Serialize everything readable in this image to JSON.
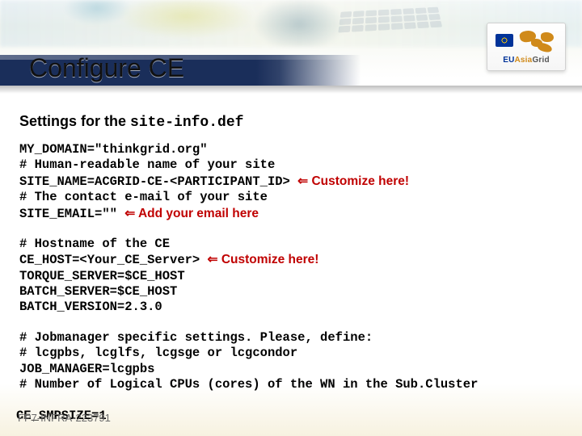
{
  "title": "Configure CE",
  "logo": {
    "eu": "EU",
    "asia": "Asia",
    "grid": "Grid"
  },
  "subhead_prefix": "Settings for the ",
  "subhead_file": "site-info.def",
  "block1": {
    "l1": "MY_DOMAIN=\"thinkgrid.org\"",
    "l2": "# Human-readable name of your site",
    "l3a": "SITE_NAME=ACGRID-CE-<PARTICIPANT_ID> ",
    "l3b": " Customize here!",
    "l4": "# The contact e-mail of your site",
    "l5a": "SITE_EMAIL=\"\" ",
    "l5b": " Add your email here"
  },
  "block2": {
    "l1": "# Hostname of the CE",
    "l2a": "CE_HOST=<Your_CE_Server> ",
    "l2b": " Customize here!",
    "l3": "TORQUE_SERVER=$CE_HOST",
    "l4": "BATCH_SERVER=$CE_HOST",
    "l5": "BATCH_VERSION=2.3.0"
  },
  "block3": {
    "l1": "# Jobmanager specific settings. Please, define:",
    "l2": "# lcgpbs, lcglfs, lcgsge or lcgcondor",
    "l3": "JOB_MANAGER=lcgpbs",
    "l4": "# Number of Logical CPUs (cores) of the WN in the Sub.Cluster"
  },
  "footer": {
    "overlay_code": "CE_SMPSIZE=1",
    "label": "FP7-INFRA-223791"
  },
  "arrow": "Ï"
}
